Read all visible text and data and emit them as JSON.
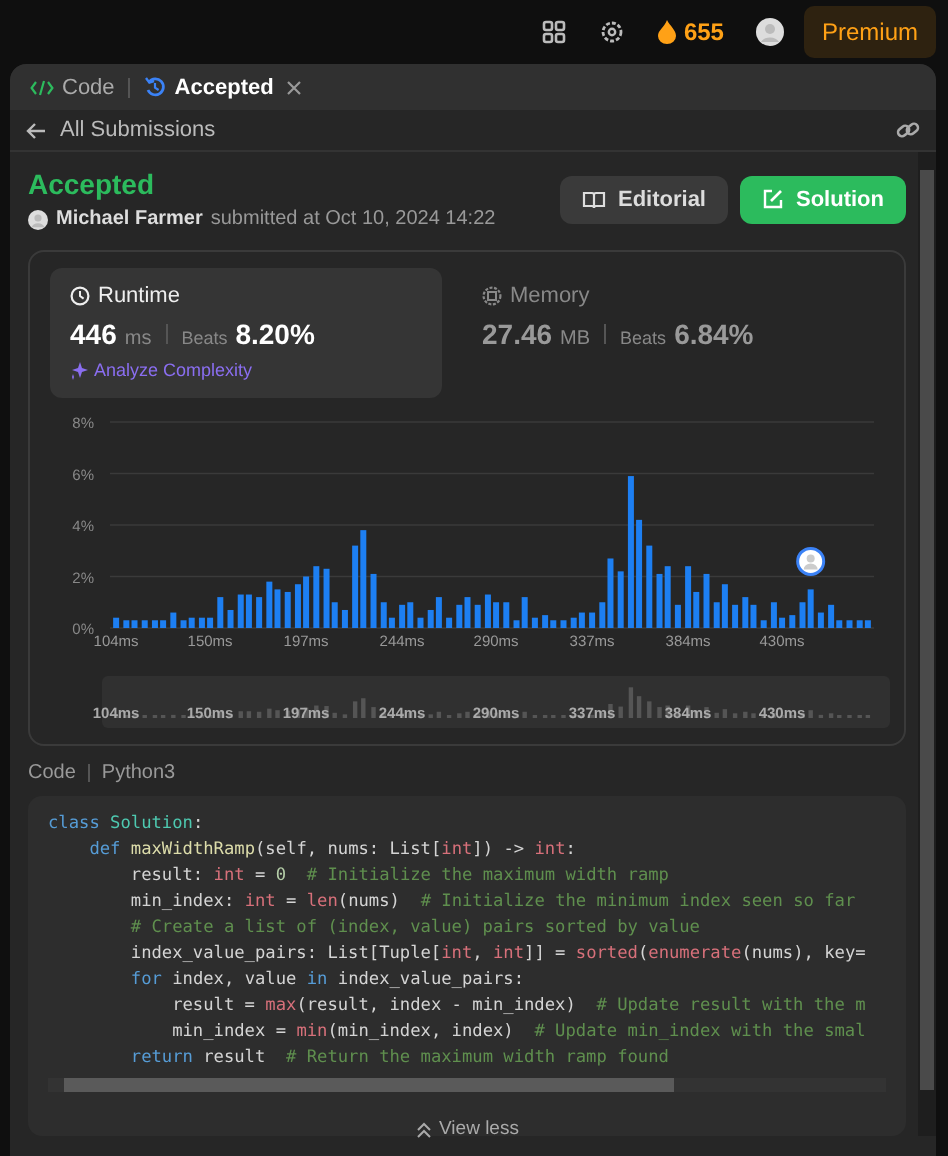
{
  "topbar": {
    "streak": "655",
    "premium": "Premium"
  },
  "tabs": [
    {
      "label": "Code",
      "kind": "code",
      "selected": false,
      "closable": false
    },
    {
      "label": "Accepted",
      "kind": "submission",
      "selected": true,
      "closable": true
    }
  ],
  "nav": {
    "back_label": "All Submissions"
  },
  "submission": {
    "status": "Accepted",
    "user": "Michael Farmer",
    "submitted": "submitted at Oct 10, 2024 14:22",
    "buttons": [
      {
        "label": "Editorial",
        "kind": "secondary"
      },
      {
        "label": "Solution",
        "kind": "primary"
      }
    ]
  },
  "metrics": [
    {
      "kind": "runtime",
      "title": "Runtime",
      "value": "446",
      "unit": "ms",
      "beats_label": "Beats",
      "beats": "8.20%",
      "selected": true,
      "action": "Analyze Complexity"
    },
    {
      "kind": "memory",
      "title": "Memory",
      "value": "27.46",
      "unit": "MB",
      "beats_label": "Beats",
      "beats": "6.84%",
      "selected": false
    }
  ],
  "chart_data": {
    "type": "bar",
    "ylim": [
      0,
      8
    ],
    "yticks": [
      {
        "value": 0,
        "label": "0%"
      },
      {
        "value": 2,
        "label": "2%"
      },
      {
        "value": 4,
        "label": "4%"
      },
      {
        "value": 6,
        "label": "6%"
      },
      {
        "value": 8,
        "label": "8%"
      }
    ],
    "grid": true,
    "xlim": [
      101,
      475
    ],
    "xticks": [
      {
        "value": 104,
        "label": "104ms"
      },
      {
        "value": 150,
        "label": "150ms"
      },
      {
        "value": 197,
        "label": "197ms"
      },
      {
        "value": 244,
        "label": "244ms"
      },
      {
        "value": 290,
        "label": "290ms"
      },
      {
        "value": 337,
        "label": "337ms"
      },
      {
        "value": 384,
        "label": "384ms"
      },
      {
        "value": 430,
        "label": "430ms"
      }
    ],
    "x": [
      104,
      109,
      113,
      118,
      123,
      127,
      132,
      137,
      141,
      146,
      150,
      155,
      160,
      165,
      169,
      174,
      179,
      183,
      188,
      193,
      197,
      202,
      207,
      211,
      216,
      221,
      225,
      230,
      235,
      239,
      244,
      248,
      253,
      258,
      262,
      267,
      272,
      276,
      281,
      286,
      290,
      295,
      300,
      304,
      309,
      314,
      318,
      323,
      328,
      332,
      337,
      342,
      346,
      351,
      356,
      360,
      365,
      370,
      374,
      379,
      384,
      388,
      393,
      398,
      402,
      407,
      412,
      416,
      421,
      426,
      430,
      435,
      440,
      444,
      449,
      454,
      458,
      463,
      468,
      472
    ],
    "values": [
      0.4,
      0.3,
      0.3,
      0.3,
      0.3,
      0.3,
      0.6,
      0.3,
      0.4,
      0.4,
      0.4,
      1.2,
      0.7,
      1.3,
      1.3,
      1.2,
      1.8,
      1.5,
      1.4,
      1.7,
      2.0,
      2.4,
      2.3,
      1.0,
      0.7,
      3.2,
      3.8,
      2.1,
      1.0,
      0.4,
      0.9,
      1.0,
      0.4,
      0.7,
      1.2,
      0.4,
      0.9,
      1.2,
      0.9,
      1.3,
      1.0,
      1.0,
      0.3,
      1.2,
      0.4,
      0.5,
      0.3,
      0.3,
      0.4,
      0.6,
      0.6,
      1.0,
      2.7,
      2.2,
      5.9,
      4.2,
      3.2,
      2.1,
      2.4,
      0.9,
      2.4,
      1.4,
      2.1,
      1.0,
      1.7,
      0.9,
      1.2,
      0.9,
      0.3,
      1.0,
      0.4,
      0.5,
      1.0,
      1.5,
      0.6,
      0.9,
      0.3,
      0.3,
      0.3,
      0.3
    ]
  },
  "overview": {
    "labels": [
      "104ms",
      "150ms",
      "197ms",
      "244ms",
      "290ms",
      "337ms",
      "384ms",
      "430ms"
    ]
  },
  "code": {
    "title": "Code",
    "language": "Python3",
    "toggle": "View less",
    "lines": [
      [
        {
          "kind": "kw",
          "text": "class "
        },
        {
          "kind": "cls",
          "text": "Solution"
        },
        {
          "kind": "plain",
          "text": ":"
        }
      ],
      [
        {
          "kind": "kw",
          "text": "    def "
        },
        {
          "kind": "fn",
          "text": "maxWidthRamp"
        },
        {
          "kind": "plain",
          "text": "(self, nums: List["
        },
        {
          "kind": "bi",
          "text": "int"
        },
        {
          "kind": "plain",
          "text": "]) -> "
        },
        {
          "kind": "bi",
          "text": "int"
        },
        {
          "kind": "plain",
          "text": ":"
        }
      ],
      [
        {
          "kind": "plain",
          "text": "        result: "
        },
        {
          "kind": "bi",
          "text": "int"
        },
        {
          "kind": "plain",
          "text": " = "
        },
        {
          "kind": "num",
          "text": "0"
        },
        {
          "kind": "cm",
          "text": "  # Initialize the maximum width ramp"
        }
      ],
      [
        {
          "kind": "plain",
          "text": "        min_index: "
        },
        {
          "kind": "bi",
          "text": "int"
        },
        {
          "kind": "plain",
          "text": " = "
        },
        {
          "kind": "bi",
          "text": "len"
        },
        {
          "kind": "plain",
          "text": "(nums)  "
        },
        {
          "kind": "cm",
          "text": "# Initialize the minimum index seen so far"
        }
      ],
      [
        {
          "kind": "cm",
          "text": "        # Create a list of (index, value) pairs sorted by value"
        }
      ],
      [
        {
          "kind": "plain",
          "text": "        index_value_pairs: List[Tuple["
        },
        {
          "kind": "bi",
          "text": "int"
        },
        {
          "kind": "plain",
          "text": ", "
        },
        {
          "kind": "bi",
          "text": "int"
        },
        {
          "kind": "plain",
          "text": "]] = "
        },
        {
          "kind": "bi",
          "text": "sorted"
        },
        {
          "kind": "plain",
          "text": "("
        },
        {
          "kind": "bi",
          "text": "enumerate"
        },
        {
          "kind": "plain",
          "text": "(nums), key="
        }
      ],
      [
        {
          "kind": "kw",
          "text": "        for"
        },
        {
          "kind": "plain",
          "text": " index, value "
        },
        {
          "kind": "kw",
          "text": "in"
        },
        {
          "kind": "plain",
          "text": " index_value_pairs:"
        }
      ],
      [
        {
          "kind": "plain",
          "text": "            result = "
        },
        {
          "kind": "bi",
          "text": "max"
        },
        {
          "kind": "plain",
          "text": "(result, index - min_index)  "
        },
        {
          "kind": "cm",
          "text": "# Update result with the m"
        }
      ],
      [
        {
          "kind": "plain",
          "text": "            min_index = "
        },
        {
          "kind": "bi",
          "text": "min"
        },
        {
          "kind": "plain",
          "text": "(min_index, index)  "
        },
        {
          "kind": "cm",
          "text": "# Update min_index with the smal"
        }
      ],
      [
        {
          "kind": "kw",
          "text": "        return"
        },
        {
          "kind": "plain",
          "text": " result  "
        },
        {
          "kind": "cm",
          "text": "# Return the maximum width ramp found"
        }
      ]
    ]
  }
}
